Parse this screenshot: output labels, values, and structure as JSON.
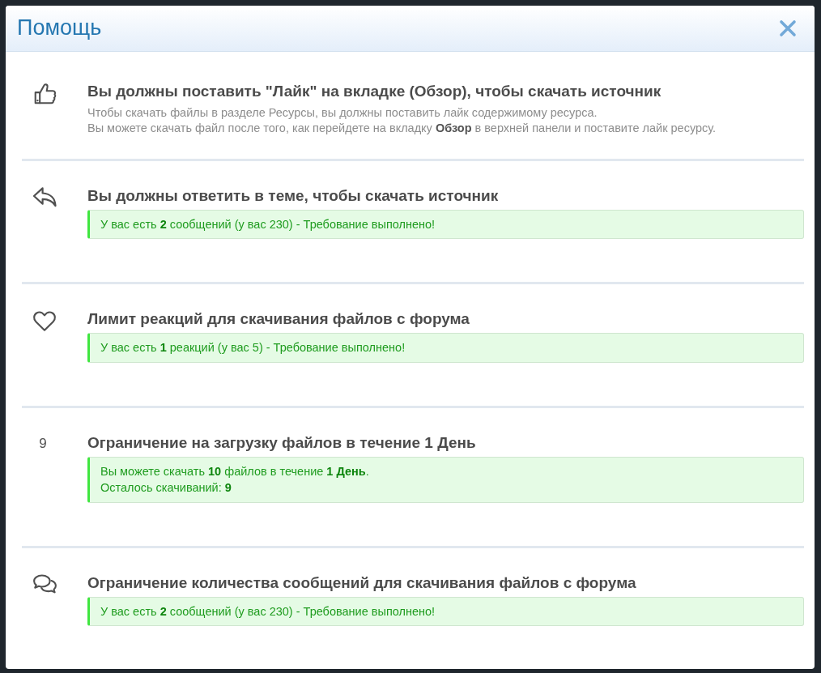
{
  "dialog": {
    "title": "Помощь"
  },
  "requirements": [
    {
      "kind": "like",
      "title": "Вы должны поставить \"Лайк\" на вкладке (Обзор), чтобы скачать источник",
      "description": [
        "Чтобы скачать файлы в разделе Ресурсы, вы должны поставить лайк содержимому ресурса.",
        "Вы можете скачать файл после того, как перейдете на вкладку **Обзор** в верхней панели и поставите лайк ресурсу."
      ]
    },
    {
      "kind": "reply",
      "title": "Вы должны ответить в теме, чтобы скачать источник",
      "notice": {
        "fulfilled": true,
        "lines": [
          "У вас есть **2** сообщений (у вас 230) - Требование выполнено!"
        ]
      }
    },
    {
      "kind": "reaction",
      "title": "Лимит реакций для скачивания файлов с форума",
      "notice": {
        "fulfilled": true,
        "lines": [
          "У вас есть **1** реакций (у вас 5) - Требование выполнено!"
        ]
      }
    },
    {
      "kind": "counter",
      "count": "9",
      "title": "Ограничение на загрузку файлов в течение 1 День",
      "notice": {
        "fulfilled": true,
        "lines": [
          "Вы можете скачать **10** файлов в течение **1 День**.",
          "Осталось скачиваний: **9**"
        ]
      }
    },
    {
      "kind": "messages",
      "title": "Ограничение количества сообщений для скачивания файлов с форума",
      "notice": {
        "fulfilled": true,
        "lines": [
          "У вас есть **2** сообщений (у вас 230) - Требование выполнено!"
        ]
      }
    }
  ]
}
